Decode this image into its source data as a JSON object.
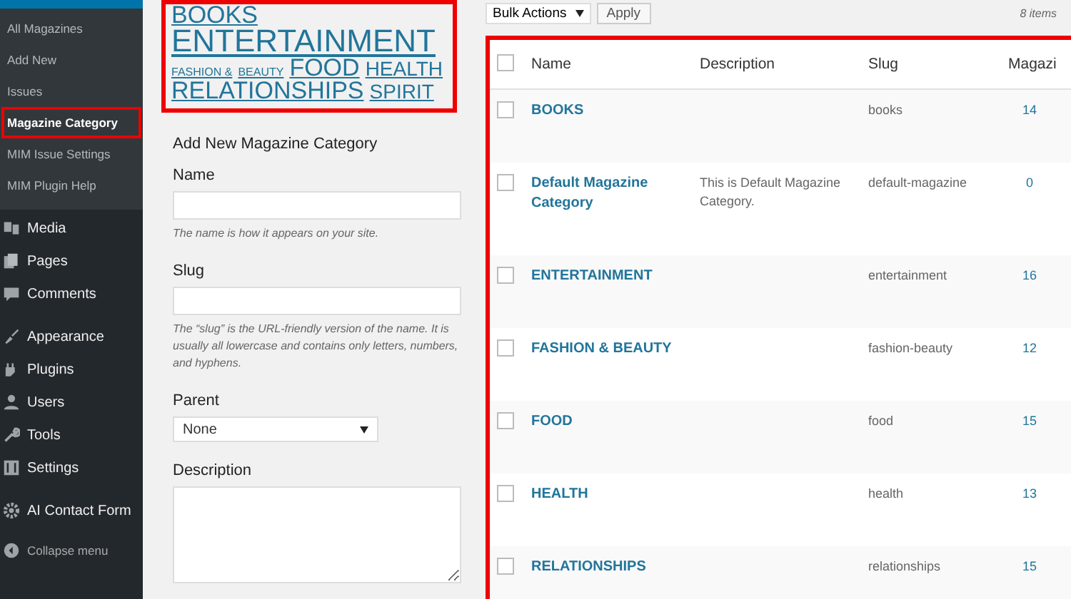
{
  "sidebar": {
    "submenu": [
      {
        "label": "All Magazines",
        "selected": false
      },
      {
        "label": "Add New",
        "selected": false
      },
      {
        "label": "Issues",
        "selected": false
      },
      {
        "label": "Magazine Category",
        "selected": true
      },
      {
        "label": "MIM Issue Settings",
        "selected": false
      },
      {
        "label": "MIM Plugin Help",
        "selected": false
      }
    ],
    "menu": [
      {
        "label": "Media"
      },
      {
        "label": "Pages"
      },
      {
        "label": "Comments"
      },
      {
        "label": "Appearance"
      },
      {
        "label": "Plugins"
      },
      {
        "label": "Users"
      },
      {
        "label": "Tools"
      },
      {
        "label": "Settings"
      },
      {
        "label": "AI Contact Form"
      }
    ],
    "collapse": "Collapse menu"
  },
  "tag_cloud": [
    {
      "label": "BOOKS",
      "kind": "l"
    },
    {
      "label": "ENTERTAINMENT",
      "kind": "xl"
    },
    {
      "label": "FASHION &",
      "kind": "s"
    },
    {
      "label": "BEAUTY",
      "kind": "s"
    },
    {
      "label": "FOOD",
      "kind": "l"
    },
    {
      "label": "HEALTH",
      "kind": "m"
    },
    {
      "label": "RELATIONSHIPS",
      "kind": "l"
    },
    {
      "label": "SPIRIT",
      "kind": "m"
    }
  ],
  "form": {
    "title": "Add New Magazine Category",
    "fields": [
      {
        "label": "Name",
        "kind": "text",
        "help": "The name is how it appears on your site."
      },
      {
        "label": "Slug",
        "kind": "text",
        "help": "The “slug” is the URL-friendly version of the name. It is usually all lowercase and contains only letters, numbers, and hyphens."
      },
      {
        "label": "Parent",
        "kind": "select",
        "value": "None"
      },
      {
        "label": "Description",
        "kind": "textarea"
      }
    ]
  },
  "bulk": {
    "action": "Bulk Actions",
    "apply": "Apply",
    "count": "8 items"
  },
  "table": {
    "select_all_checked": false,
    "columns": [
      "Name",
      "Description",
      "Slug",
      "Magazi"
    ],
    "rows": [
      {
        "name": "BOOKS",
        "description": "",
        "slug": "books",
        "count": "14",
        "checked": false
      },
      {
        "name": "Default Magazine Category",
        "description": "This is Default Magazine Category.",
        "slug": "default-magazine",
        "count": "0",
        "checked": false
      },
      {
        "name": "ENTERTAINMENT",
        "description": "",
        "slug": "entertainment",
        "count": "16",
        "checked": false
      },
      {
        "name": "FASHION & BEAUTY",
        "description": "",
        "slug": "fashion-beauty",
        "count": "12",
        "checked": false
      },
      {
        "name": "FOOD",
        "description": "",
        "slug": "food",
        "count": "15",
        "checked": false
      },
      {
        "name": "HEALTH",
        "description": "",
        "slug": "health",
        "count": "13",
        "checked": false
      },
      {
        "name": "RELATIONSHIPS",
        "description": "",
        "slug": "relationships",
        "count": "15",
        "checked": false
      }
    ]
  }
}
